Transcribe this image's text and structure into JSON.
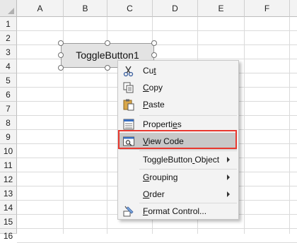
{
  "columns": [
    "A",
    "B",
    "C",
    "D",
    "E",
    "F"
  ],
  "rows": [
    "1",
    "2",
    "3",
    "4",
    "5",
    "6",
    "7",
    "8",
    "9",
    "10",
    "11",
    "12",
    "13",
    "14",
    "15",
    "16"
  ],
  "control": {
    "label": "ToggleButton1"
  },
  "context_menu": {
    "items": [
      {
        "label": "Cut",
        "icon": "scissors-icon"
      },
      {
        "label": "Copy",
        "icon": "copy-icon"
      },
      {
        "label": "Paste",
        "icon": "paste-icon"
      },
      {
        "label": "Properties",
        "icon": "properties-icon"
      },
      {
        "label": "View Code",
        "icon": "view-code-icon"
      },
      {
        "label": "ToggleButton Object",
        "icon": "",
        "submenu": true
      },
      {
        "label": "Grouping",
        "icon": "",
        "submenu": true
      },
      {
        "label": "Order",
        "icon": "",
        "submenu": true
      },
      {
        "label": "Format Control...",
        "icon": "format-control-icon"
      }
    ],
    "selected": "View Code"
  },
  "colors": {
    "highlight": "#e8382f",
    "menu_bg": "#f3f3f3",
    "selected_bg": "#c8c8c8"
  }
}
